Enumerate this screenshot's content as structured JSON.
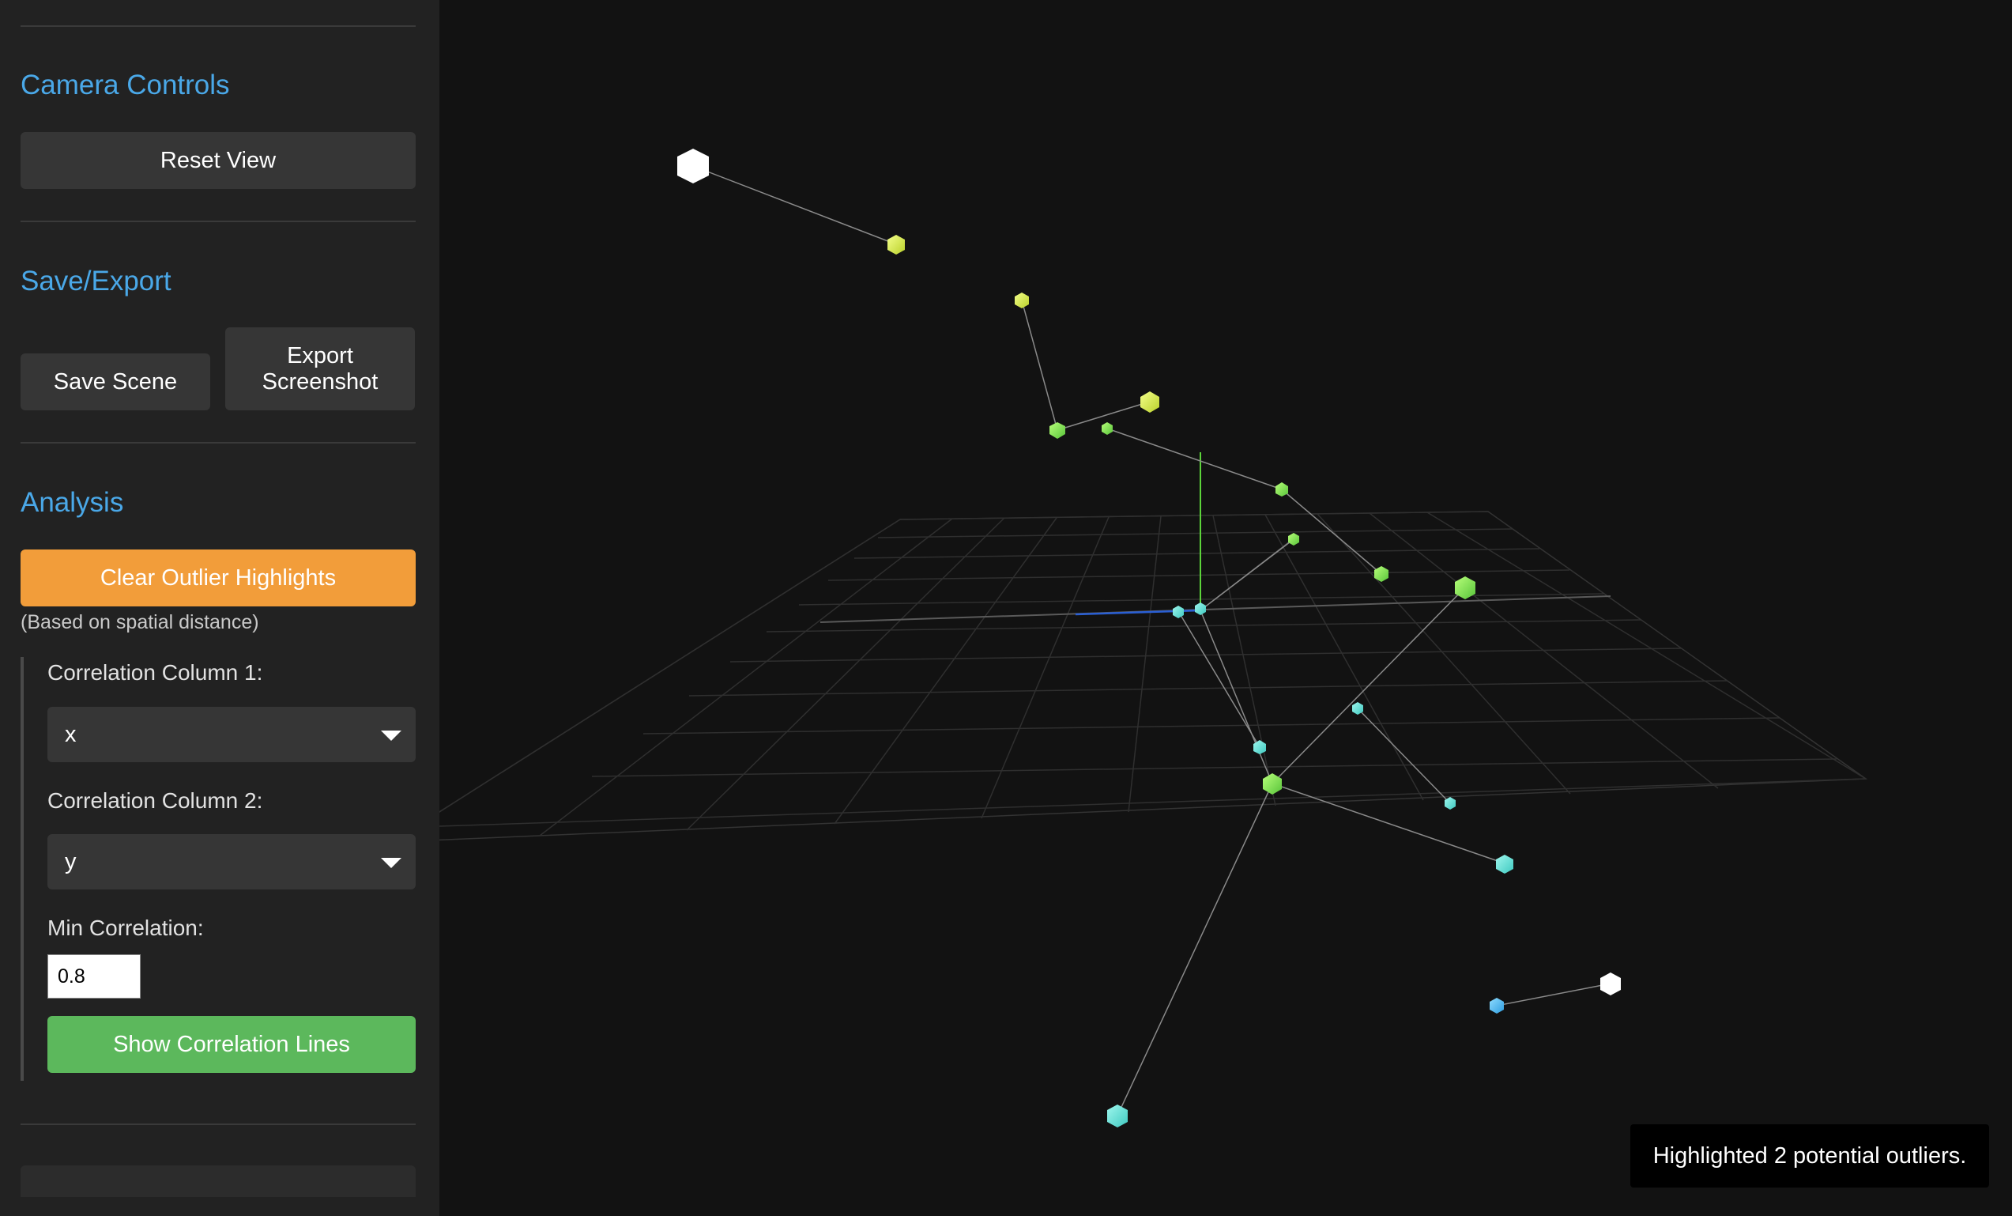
{
  "camera": {
    "title": "Camera Controls",
    "reset_label": "Reset View"
  },
  "save_export": {
    "title": "Save/Export",
    "save_label": "Save Scene",
    "export_label": "Export Screenshot"
  },
  "analysis": {
    "title": "Analysis",
    "clear_outliers_label": "Clear Outlier Highlights",
    "outlier_hint": "(Based on spatial distance)",
    "corr_col1_label": "Correlation Column 1:",
    "corr_col1_value": "x",
    "corr_col2_label": "Correlation Column 2:",
    "corr_col2_value": "y",
    "min_corr_label": "Min Correlation:",
    "min_corr_value": "0.8",
    "show_corr_label": "Show Correlation Lines"
  },
  "status": {
    "message": "Highlighted 2 potential outliers."
  },
  "colors": {
    "accent": "#4aa8e8",
    "orange_button": "#f29d3a",
    "green_button": "#5cb85c",
    "sidebar_bg": "#222222",
    "viewport_bg": "#121212"
  }
}
